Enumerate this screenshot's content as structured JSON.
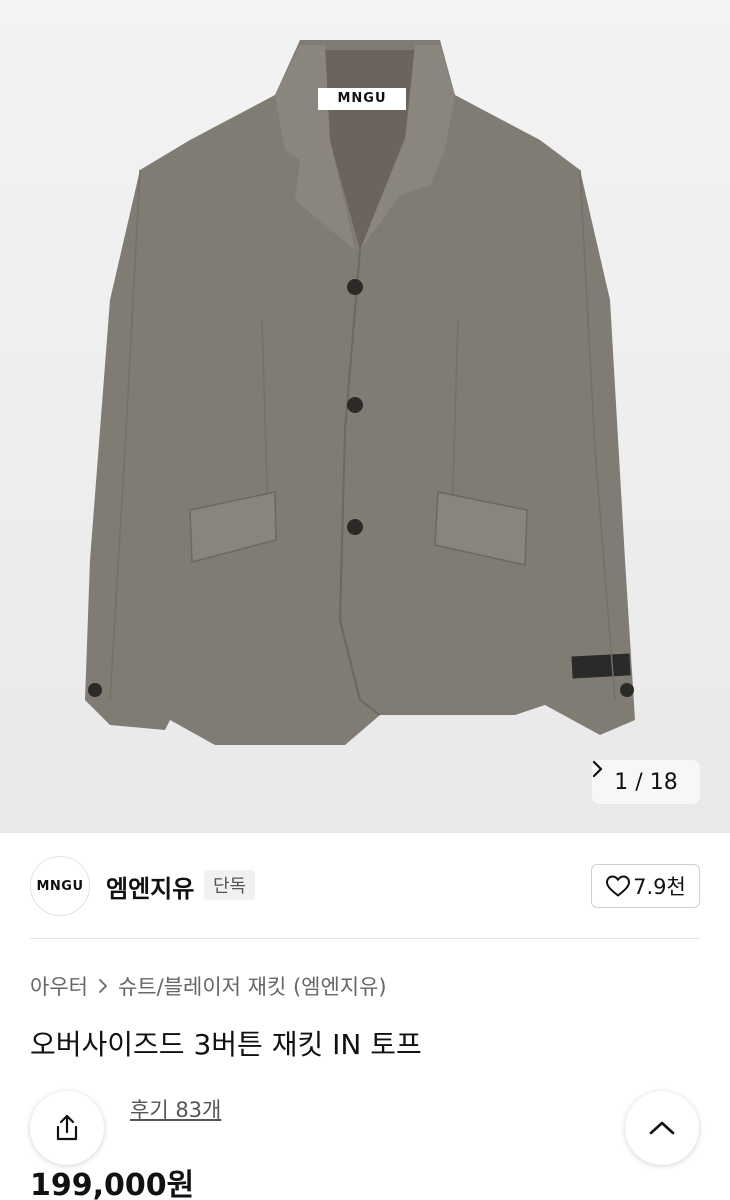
{
  "gallery": {
    "label_text": "MNGU",
    "current": "1",
    "separator": "/",
    "total": "18",
    "next_icon": "chevron-right-icon"
  },
  "brand": {
    "logo_text": "MNGU",
    "name": "엠엔지유",
    "badge": "단독",
    "likes": "7.9천",
    "like_icon": "heart-outline-icon"
  },
  "breadcrumb": {
    "items": [
      "아우터",
      "슈트/블레이저 재킷 (엠엔지유)"
    ]
  },
  "product": {
    "title": "오버사이즈드 3버튼 재킷 IN 토프",
    "reviews": "후기 83개",
    "price": "199,000원"
  },
  "colors": {
    "jacket": "#7f7a72",
    "background": "#eeeeee",
    "star": "#f5b400"
  },
  "floating": {
    "share_icon": "share-icon",
    "scroll_top_icon": "chevron-up-icon"
  }
}
